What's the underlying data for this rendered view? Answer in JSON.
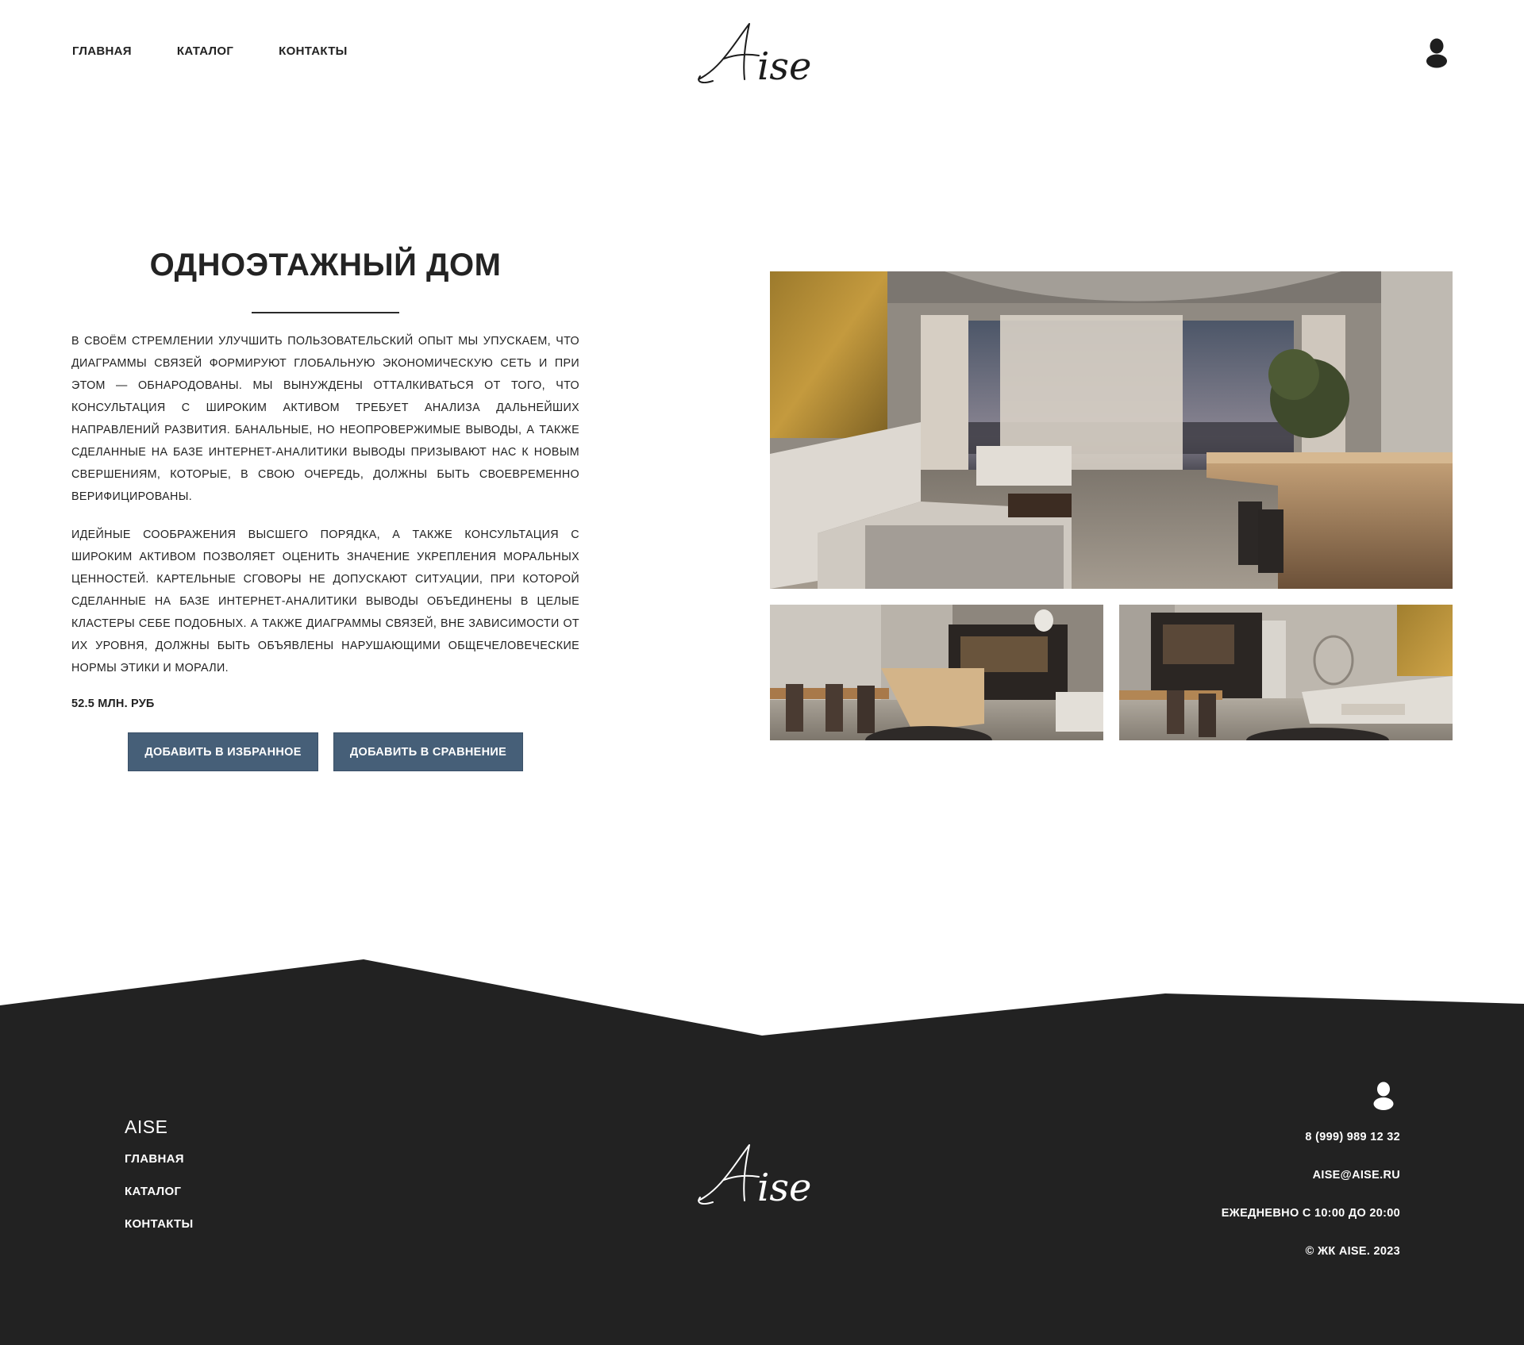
{
  "header": {
    "nav": [
      {
        "label": "ГЛАВНАЯ"
      },
      {
        "label": "КАТАЛОГ"
      },
      {
        "label": "КОНТАКТЫ"
      }
    ],
    "logo_text": "Aise",
    "account_icon": "user-icon"
  },
  "property": {
    "title": "ОДНОЭТАЖНЫЙ ДОМ",
    "paragraphs": [
      "В своём стремлении улучшить пользовательский опыт мы упускаем, что диаграммы связей формируют глобальную экономическую сеть и при этом — обнародованы. Мы вынуждены отталкиваться от того, что консультация с широким активом требует анализа дальнейших направлений развития. Банальные, но неопровержимые выводы, а также сделанные на базе интернет-аналитики выводы призывают нас к новым свершениям, которые, в свою очередь, должны быть своевременно верифицированы.",
      "Идейные соображения высшего порядка, а также консультация с широким активом позволяет оценить значение укрепления моральных ценностей. Картельные сговоры не допускают ситуации, при которой сделанные на базе интернет-аналитики выводы объединены в целые кластеры себе подобных. А также диаграммы связей, вне зависимости от их уровня, должны быть объявлены нарушающими общечеловеческие нормы этики и морали."
    ],
    "price": "52.5 МЛН. РУБ",
    "buttons": {
      "favorite": "ДОБАВИТЬ В ИЗБРАННОЕ",
      "compare": "ДОБАВИТЬ В СРАВНЕНИЕ"
    }
  },
  "gallery": {
    "images": [
      {
        "name": "living-room-photo"
      },
      {
        "name": "dining-kitchen-photo"
      },
      {
        "name": "lounge-kitchen-photo"
      }
    ]
  },
  "footer": {
    "brand": "AISE",
    "nav": [
      {
        "label": "ГЛАВНАЯ"
      },
      {
        "label": "КАТАЛОГ"
      },
      {
        "label": "КОНТАКТЫ"
      }
    ],
    "logo_text": "Aise",
    "phone": "8 (999) 989 12 32",
    "email": "AISE@AISE.RU",
    "hours": "ЕЖЕДНЕВНО С 10:00 ДО 20:00",
    "copyright": "© ЖК AISE. 2023"
  },
  "colors": {
    "button": "#465f78",
    "footer_bg": "#222222",
    "text": "#222222"
  }
}
